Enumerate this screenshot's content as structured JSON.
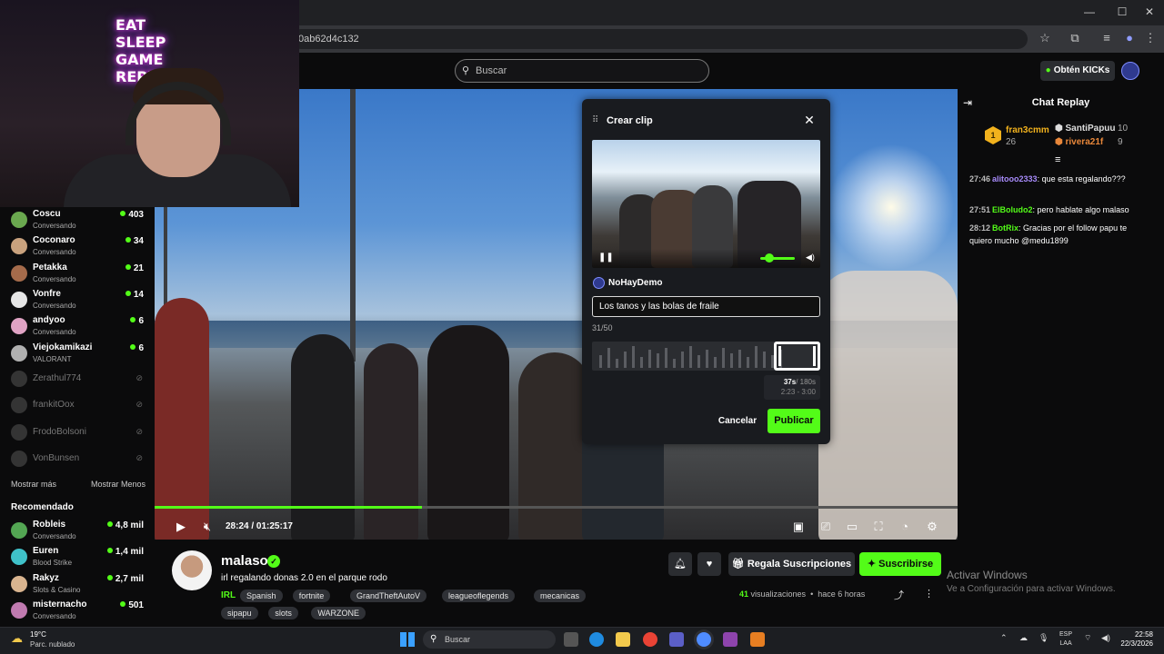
{
  "browser": {
    "address_fragment": "0ab62d4c132",
    "window_controls": [
      "—",
      "☐",
      "✕"
    ]
  },
  "site": {
    "search_placeholder": "Buscar",
    "kicks_label": "Obtén KICKs"
  },
  "webcam": {
    "neon_sign": [
      "EAT",
      "SLEEP",
      "GAME",
      "REPE"
    ]
  },
  "sidebar": {
    "following": [
      {
        "name": "Coscu",
        "category": "Conversando",
        "viewers": "403",
        "color": "#6aa84f"
      },
      {
        "name": "Coconaro",
        "category": "Conversando",
        "viewers": "34",
        "color": "#c9a27e"
      },
      {
        "name": "Petakka",
        "category": "Conversando",
        "viewers": "21",
        "color": "#a56b4b"
      },
      {
        "name": "Vonfre",
        "category": "Conversando",
        "viewers": "14",
        "color": "#e6e6e6"
      },
      {
        "name": "andyoo",
        "category": "Conversando",
        "viewers": "6",
        "color": "#e0a3c4"
      },
      {
        "name": "Viejokamikazi",
        "category": "VALORANT",
        "viewers": "6",
        "color": "#b0b0b0"
      }
    ],
    "offline": [
      "Zerathul774",
      "frankitOox",
      "FrodoBolsoni",
      "VonBunsen"
    ],
    "show_more": "Mostrar más",
    "show_less": "Mostrar Menos",
    "recommended_title": "Recomendado",
    "recommended": [
      {
        "name": "Robleis",
        "category": "Conversando",
        "viewers": "4,8 mil",
        "color": "#53a653"
      },
      {
        "name": "Euren",
        "category": "Blood Strike",
        "viewers": "1,4 mil",
        "color": "#3fc1c9"
      },
      {
        "name": "Rakyz",
        "category": "Slots & Casino",
        "viewers": "2,7 mil",
        "color": "#d9b48f"
      },
      {
        "name": "misternacho",
        "category": "Conversando",
        "viewers": "501",
        "color": "#c07ab0"
      }
    ]
  },
  "player": {
    "time": "28:24 / 01:25:17",
    "progress_fraction": 0.333
  },
  "clip_modal": {
    "title": "Crear clip",
    "author": "NoHayDemo",
    "clip_title_value": "Los tanos y las bolas de fraile",
    "char_counter": "31/50",
    "duration_selected": "37s",
    "duration_max": "/ 180s",
    "range": "2:23 - 3:00",
    "cancel_label": "Cancelar",
    "publish_label": "Publicar"
  },
  "chat": {
    "title": "Chat Replay",
    "gifters": [
      {
        "rank": "1",
        "name": "fran3cmm",
        "count": "26"
      },
      {
        "rank": "2",
        "name": "SantiPapuu",
        "count": "10"
      },
      {
        "rank": "3",
        "name": "rivera21f",
        "count": "9"
      }
    ],
    "messages": [
      {
        "time": "27:46",
        "user": "alitooo2333",
        "color": "#a78bfa",
        "text": "que esta regalando???"
      },
      {
        "time": "27:51",
        "user": "ElBoludo2",
        "color": "#53fc18",
        "text": "pero hablate algo malaso"
      },
      {
        "time": "28:12",
        "user": "BotRix",
        "color": "#53fc18",
        "text": "Gracias por el follow papu te quiero mucho @medu1899"
      }
    ]
  },
  "stream_info": {
    "streamer": "malaso",
    "title": "irl regalando donas 2.0 en el parque rodo",
    "category": "IRL",
    "tags": [
      "Spanish",
      "fortnite",
      "GrandTheftAutoV",
      "leagueoflegends",
      "mecanicas",
      "sipapu",
      "slots",
      "WARZONE"
    ],
    "gift_label": "Regala Suscripciones",
    "subscribe_label": "Suscribirse",
    "views": "41",
    "views_label": "visualizaciones",
    "age": "hace 6 horas"
  },
  "windows_watermark": {
    "line1": "Activar Windows",
    "line2": "Ve a Configuración para activar Windows."
  },
  "taskbar": {
    "temperature": "19°C",
    "condition": "Parc. nublado",
    "search_placeholder": "Buscar",
    "lang_line1": "ESP",
    "lang_line2": "LAA",
    "clock_time": "22:58",
    "clock_date": "22/3/2026"
  }
}
